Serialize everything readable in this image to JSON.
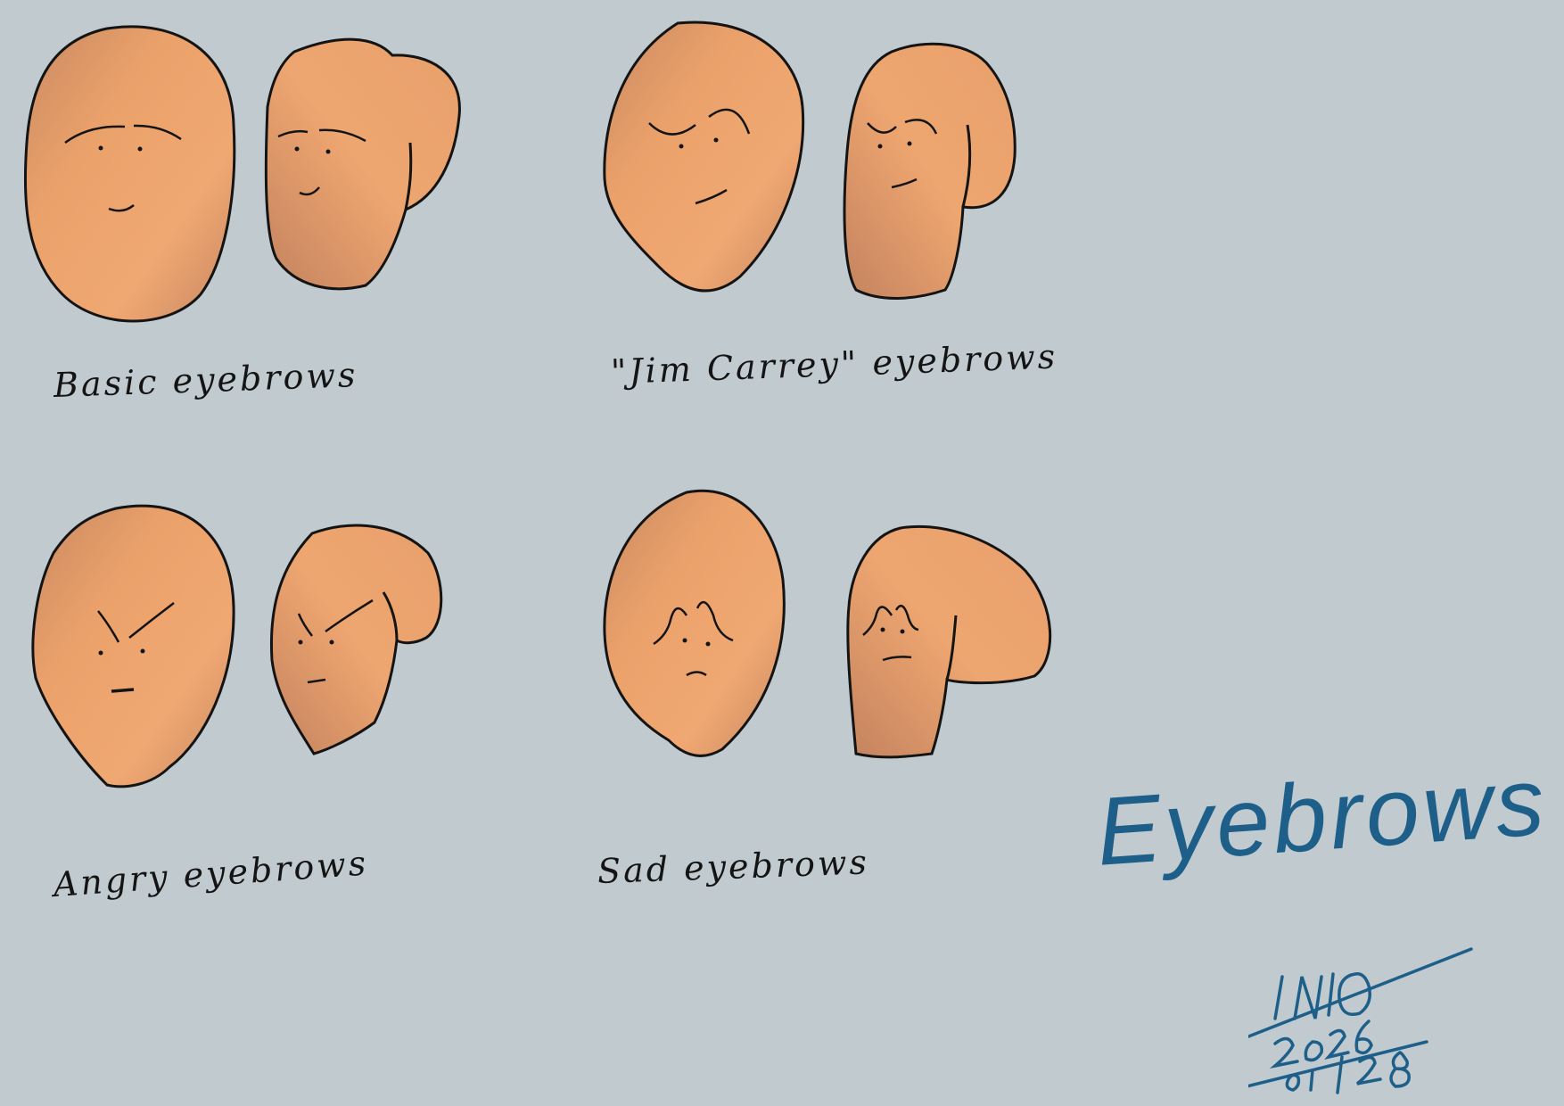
{
  "title": "Eyebrows",
  "colors": {
    "background": "#c1cbcf",
    "skin": "#e9a06c",
    "skin_shade": "#c98a63",
    "outline": "#141414",
    "ink_blue": "#1e5f8a"
  },
  "panels": [
    {
      "name": "basic",
      "label": "Basic eyebrows",
      "expression": "basic"
    },
    {
      "name": "jim-carrey",
      "label": "\"Jim Carrey\" eyebrows",
      "expression": "arched"
    },
    {
      "name": "angry",
      "label": "Angry eyebrows",
      "expression": "angry"
    },
    {
      "name": "sad",
      "label": "Sad eyebrows",
      "expression": "sad"
    }
  ],
  "signature": {
    "text": "INIO 2026 01 28",
    "style": "handwritten"
  }
}
